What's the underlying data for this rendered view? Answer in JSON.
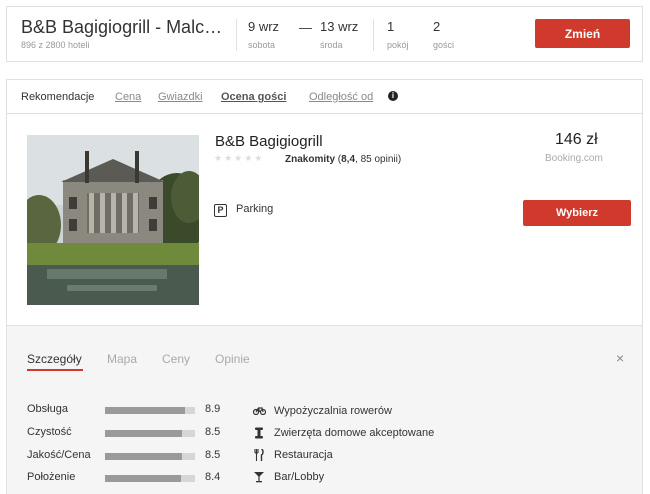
{
  "search": {
    "title": "B&B Bagigiogrill - Malcontenta",
    "subtitle": "896 z 2800 hoteli",
    "checkin": {
      "value": "9 wrz",
      "label": "sobota"
    },
    "separator": "—",
    "checkout": {
      "value": "13 wrz",
      "label": "środa"
    },
    "rooms": {
      "value": "1",
      "label": "pokój"
    },
    "guests": {
      "value": "2",
      "label": "gości"
    },
    "change_label": "Zmień"
  },
  "sort": {
    "label": "Rekomendacje",
    "options": [
      {
        "label": "Cena",
        "active": false
      },
      {
        "label": "Gwiazdki",
        "active": false
      },
      {
        "label": "Ocena gości",
        "active": true
      },
      {
        "label": "Odległość od",
        "active": false
      }
    ],
    "info_icon": "info-icon"
  },
  "hotel": {
    "name": "B&B Bagigiogrill",
    "stars": "★★★★★",
    "rating_word": "Znakomity",
    "rating_score": "8,4",
    "rating_reviews": "85 opinii",
    "price": "146 zł",
    "price_source": "Booking.com",
    "amenity_badge": "Parking",
    "amenity_icon": "P",
    "select_label": "Wybierz"
  },
  "details": {
    "tabs": [
      {
        "label": "Szczegóły",
        "active": true
      },
      {
        "label": "Mapa",
        "active": false
      },
      {
        "label": "Ceny",
        "active": false
      },
      {
        "label": "Opinie",
        "active": false
      }
    ],
    "close_symbol": "×",
    "scores": [
      {
        "label": "Obsługa",
        "value": "8.9",
        "fraction": 0.89
      },
      {
        "label": "Czystość",
        "value": "8.5",
        "fraction": 0.85
      },
      {
        "label": "Jakość/Cena",
        "value": "8.5",
        "fraction": 0.85
      },
      {
        "label": "Położenie",
        "value": "8.4",
        "fraction": 0.84
      }
    ],
    "amenities": [
      {
        "icon": "bicycle-icon",
        "glyph": "🚲",
        "label": "Wypożyczalnia rowerów"
      },
      {
        "icon": "pet-icon",
        "glyph": "🦴",
        "label": "Zwierzęta domowe akceptowane"
      },
      {
        "icon": "restaurant-icon",
        "glyph": "🍴",
        "label": "Restauracja"
      },
      {
        "icon": "bar-icon",
        "glyph": "🍸",
        "label": "Bar/Lobby"
      }
    ]
  }
}
